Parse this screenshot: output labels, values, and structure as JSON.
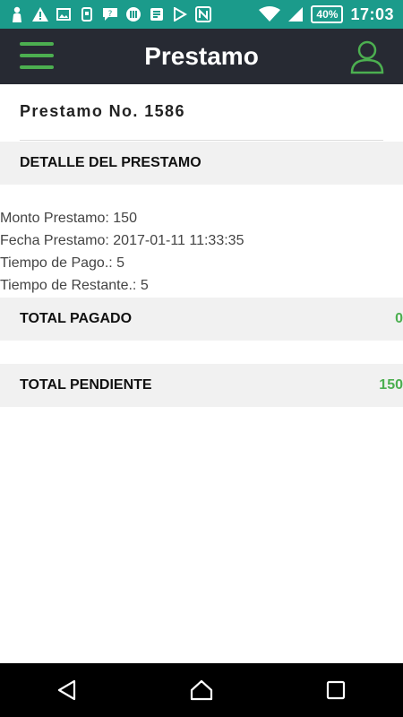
{
  "status_bar": {
    "battery": "40%",
    "time": "17:03",
    "icons": [
      "person-icon",
      "warning-icon",
      "image-icon",
      "phone-icon",
      "chat-icon",
      "radio-icon",
      "document-icon",
      "play-store-icon",
      "nfc-icon",
      "wifi-icon",
      "signal-icon",
      "battery-icon"
    ]
  },
  "app_bar": {
    "title": "Prestamo",
    "menu_icon": "hamburger-menu-icon",
    "profile_icon": "user-profile-icon",
    "accent_color": "#4caf50",
    "background_color": "#272a33"
  },
  "loan": {
    "header": "Prestamo No. 1586",
    "detail_section_title": "DETALLE DEL PRESTAMO",
    "details": [
      "Monto Prestamo: 150",
      "Fecha Prestamo: 2017-01-11 11:33:35",
      "Tiempo de Pago.: 5",
      "Tiempo de Restante.: 5"
    ],
    "total_paid_label": "TOTAL PAGADO",
    "total_paid_value": "0",
    "total_pending_label": "TOTAL PENDIENTE",
    "total_pending_value": "150"
  },
  "nav_bar": {
    "back_icon": "back-triangle-icon",
    "home_icon": "home-icon",
    "recents_icon": "recents-square-icon"
  }
}
